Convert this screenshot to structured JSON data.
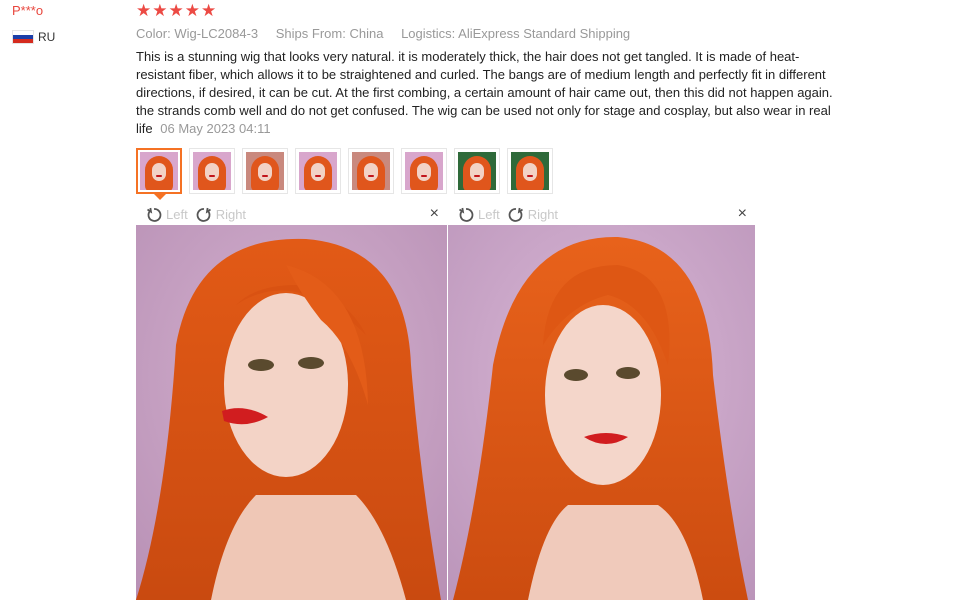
{
  "reviewer": {
    "name": "P***o",
    "country": "RU"
  },
  "review": {
    "stars": 5,
    "color_label": "Color:",
    "color_value": "Wig-LC2084-3",
    "ships_label": "Ships From:",
    "ships_value": "China",
    "logistics_label": "Logistics:",
    "logistics_value": "AliExpress Standard Shipping",
    "text": "This is a stunning wig that looks very natural. it is moderately thick, the hair does not get tangled. It is made of heat-resistant fiber, which allows it to be straightened and curled. The bangs are of medium length and perfectly fit in different directions, if desired, it can be cut. At the first combing, a certain amount of hair came out, then this did not happen again. the strands comb well and do not get confused. The wig can be used not only for stage and cosplay, but also wear in real life",
    "date": "06 May 2023 04:11"
  },
  "thumbnails": [
    {
      "bg": "pink"
    },
    {
      "bg": "pink"
    },
    {
      "bg": "rose"
    },
    {
      "bg": "pink"
    },
    {
      "bg": "rose"
    },
    {
      "bg": "pink"
    },
    {
      "bg": "green"
    },
    {
      "bg": "green"
    }
  ],
  "viewer": {
    "left_label": "Left",
    "right_label": "Right",
    "close_icon": "×"
  },
  "colors": {
    "accent": "#f57224",
    "star": "#ec4a44",
    "name": "#e8473e",
    "hair": "#e0561c",
    "backdrop": "#c69fc0"
  }
}
